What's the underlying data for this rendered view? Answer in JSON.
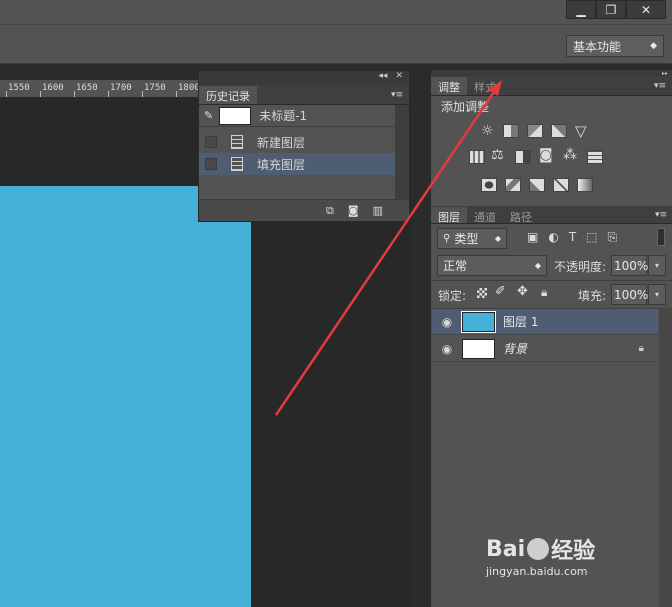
{
  "workspace": {
    "selected": "基本功能"
  },
  "ruler": {
    "ticks": [
      "1550",
      "1600",
      "1650",
      "1700",
      "1750",
      "1800"
    ]
  },
  "history_panel": {
    "tab_label": "历史记录",
    "snapshot_label": "未标题-1",
    "items": [
      {
        "label": "新建图层",
        "selected": false
      },
      {
        "label": "填充图层",
        "selected": true
      }
    ]
  },
  "adjustments_panel": {
    "tabs": [
      "调整",
      "样式"
    ],
    "active_tab": "调整",
    "heading": "添加调整"
  },
  "layers_panel": {
    "tabs": [
      "图层",
      "通道",
      "路径"
    ],
    "active_tab": "图层",
    "filter_kind": "类型",
    "blend_mode": "正常",
    "opacity_label": "不透明度:",
    "opacity_value": "100%",
    "lock_label": "锁定:",
    "fill_label": "填充:",
    "fill_value": "100%",
    "layers": [
      {
        "name": "图层 1",
        "selected": true,
        "thumb_color": "#45b0d8"
      },
      {
        "name": "背景",
        "selected": false,
        "thumb_color": "#ffffff",
        "locked": true
      }
    ]
  },
  "canvas": {
    "fill_color": "#45b0d8"
  },
  "watermark": {
    "brand": "Bai",
    "brand2": "经验",
    "url": "jingyan.baidu.com"
  }
}
